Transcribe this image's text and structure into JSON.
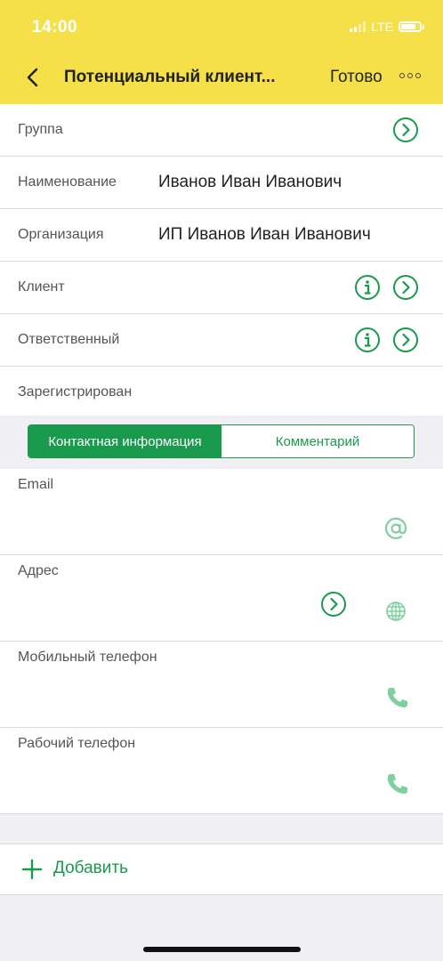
{
  "status_bar": {
    "time": "14:00",
    "network": "LTE"
  },
  "nav": {
    "title": "Потенциальный клиент...",
    "done_label": "Готово"
  },
  "fields": [
    {
      "label": "Группа",
      "value": ""
    },
    {
      "label": "Наименование",
      "value": "Иванов Иван Иванович"
    },
    {
      "label": "Организация",
      "value": "ИП Иванов Иван Иванович"
    },
    {
      "label": "Клиент",
      "value": ""
    },
    {
      "label": "Ответственный",
      "value": ""
    },
    {
      "label": "Зарегистрирован",
      "value": ""
    }
  ],
  "tabs": [
    {
      "label": "Контактная информация",
      "active": true
    },
    {
      "label": "Комментарий",
      "active": false
    }
  ],
  "contacts": [
    {
      "label": "Email",
      "icon": "at-icon"
    },
    {
      "label": "Адрес",
      "icon": "globe-icon"
    },
    {
      "label": "Мобильный телефон",
      "icon": "phone-icon"
    },
    {
      "label": "Рабочий телефон",
      "icon": "phone-icon"
    }
  ],
  "add_label": "Добавить",
  "colors": {
    "header": "#f5e04a",
    "accent": "#1a9a4c",
    "icon_light": "#7fcf9f"
  }
}
